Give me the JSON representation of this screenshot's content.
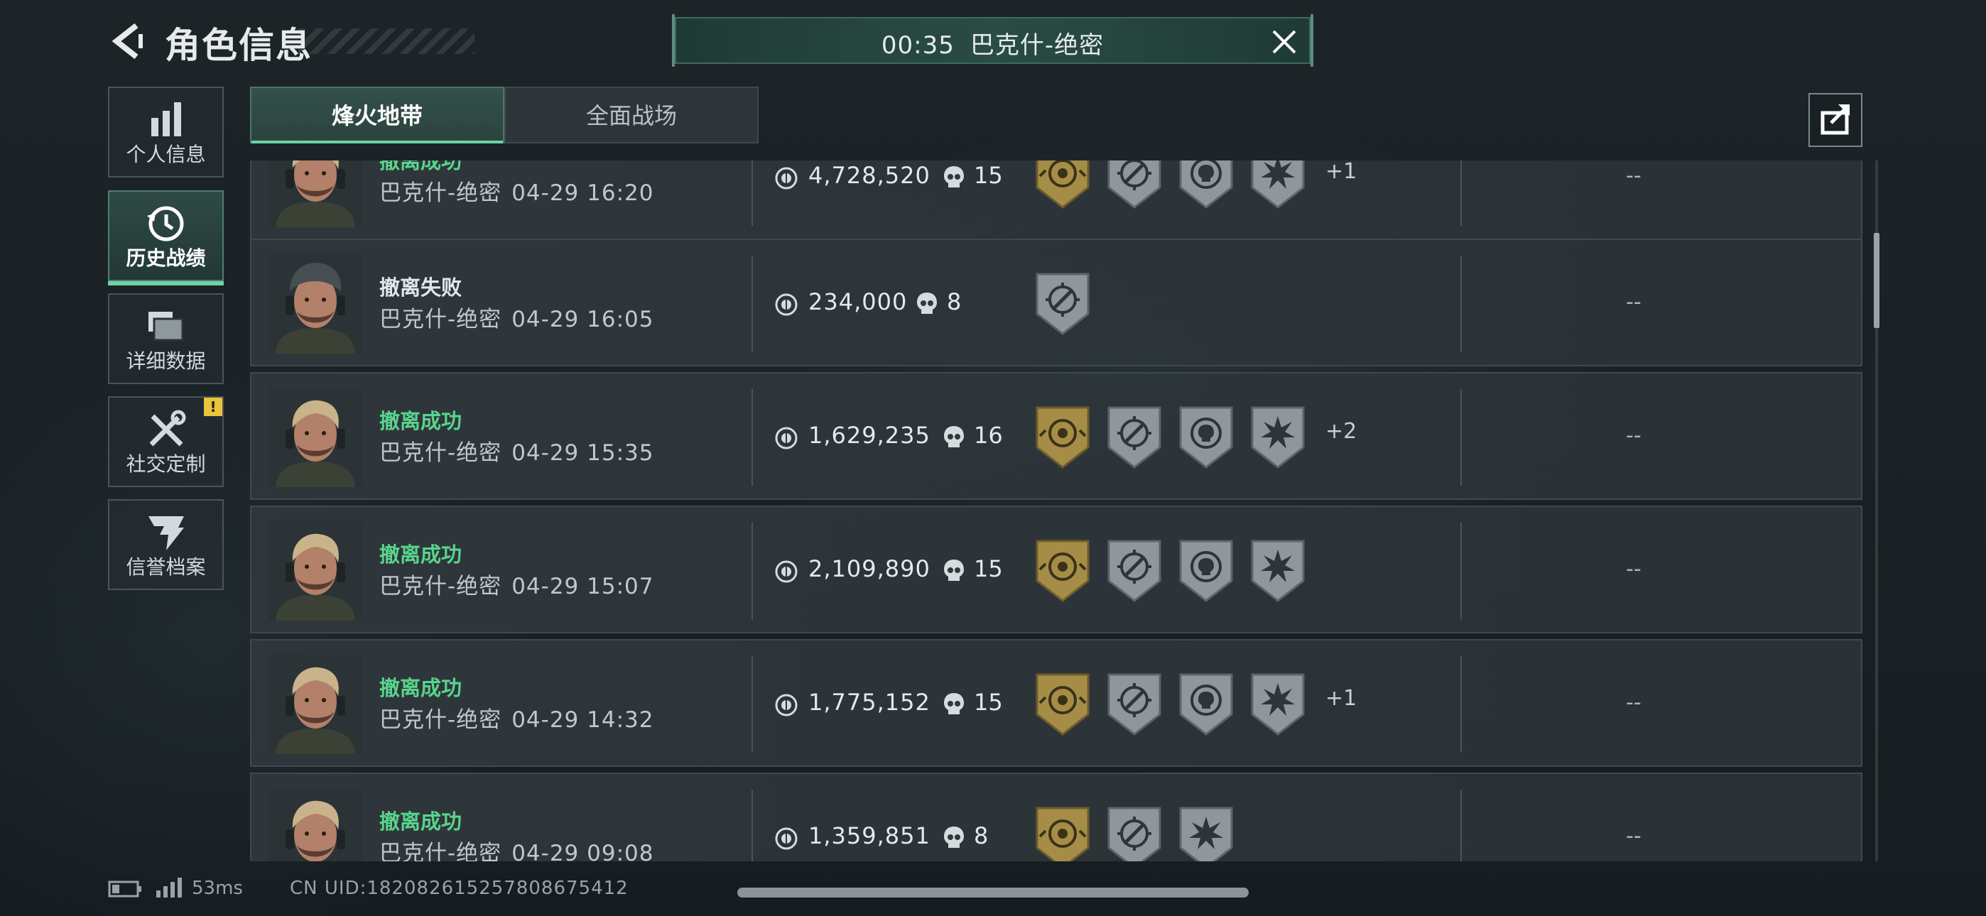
{
  "header": {
    "title": "角色信息"
  },
  "match_banner": {
    "time": "00:35",
    "map": "巴克什-绝密"
  },
  "sidebar": {
    "items": [
      {
        "label": "个人信息",
        "icon": "bar-chart-icon"
      },
      {
        "label": "历史战绩",
        "icon": "history-clock-icon",
        "active": true
      },
      {
        "label": "详细数据",
        "icon": "folders-icon"
      },
      {
        "label": "社交定制",
        "icon": "tools-icon",
        "badge": "!"
      },
      {
        "label": "信誉档案",
        "icon": "shield-bolt-icon"
      }
    ]
  },
  "tabs": [
    {
      "label": "烽火地带",
      "active": true
    },
    {
      "label": "全面战场"
    }
  ],
  "records": [
    {
      "outcome": "撤离成功",
      "map": "巴克什-绝密",
      "datetime": "04-29 16:20",
      "value": "4,728,520",
      "kills": "15",
      "extra": "+1",
      "result": "--",
      "success": true
    },
    {
      "outcome": "撤离失败",
      "map": "巴克什-绝密",
      "datetime": "04-29 16:05",
      "value": "234,000",
      "kills": "8",
      "extra": "",
      "result": "--",
      "success": false
    },
    {
      "outcome": "撤离成功",
      "map": "巴克什-绝密",
      "datetime": "04-29 15:35",
      "value": "1,629,235",
      "kills": "16",
      "extra": "+2",
      "result": "--",
      "success": true
    },
    {
      "outcome": "撤离成功",
      "map": "巴克什-绝密",
      "datetime": "04-29 15:07",
      "value": "2,109,890",
      "kills": "15",
      "extra": "",
      "result": "--",
      "success": true
    },
    {
      "outcome": "撤离成功",
      "map": "巴克什-绝密",
      "datetime": "04-29 14:32",
      "value": "1,775,152",
      "kills": "15",
      "extra": "+1",
      "result": "--",
      "success": true
    },
    {
      "outcome": "撤离成功",
      "map": "巴克什-绝密",
      "datetime": "04-29 09:08",
      "value": "1,359,851",
      "kills": "8",
      "extra": "",
      "result": "--",
      "success": true
    }
  ],
  "footer": {
    "ping": "53ms",
    "uid": "CN UID:182082615257808675412"
  },
  "colors": {
    "accent": "#6fd3a5",
    "success": "#59d48c",
    "gold_badge": "#b39a52",
    "panel": "#30383d"
  }
}
